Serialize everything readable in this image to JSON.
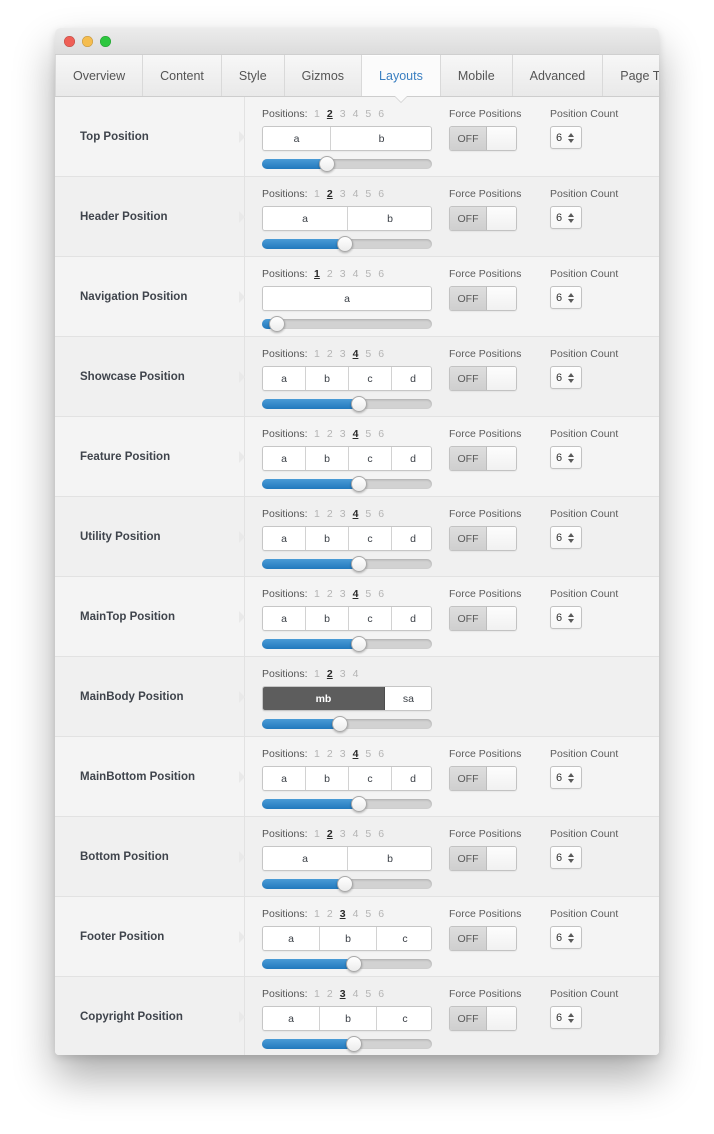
{
  "window": {
    "traffic_lights": [
      "close",
      "minimize",
      "maximize"
    ],
    "accent_blue": "#2279bd",
    "active_tab_color": "#3a7fc1"
  },
  "tabs": [
    {
      "label": "Overview",
      "active": false
    },
    {
      "label": "Content",
      "active": false
    },
    {
      "label": "Style",
      "active": false
    },
    {
      "label": "Gizmos",
      "active": false
    },
    {
      "label": "Layouts",
      "active": true
    },
    {
      "label": "Mobile",
      "active": false
    },
    {
      "label": "Advanced",
      "active": false
    },
    {
      "label": "Page Templates",
      "active": false
    }
  ],
  "labels": {
    "positions": "Positions:",
    "force_positions": "Force Positions",
    "position_count": "Position Count",
    "toggle_off": "OFF"
  },
  "rows": [
    {
      "name": "Top Position",
      "position_numbers": [
        "1",
        "2",
        "3",
        "4",
        "5",
        "6"
      ],
      "selected_position": "2",
      "segments": [
        {
          "label": "a",
          "width": 40,
          "dark": false
        },
        {
          "label": "b",
          "width": 60,
          "dark": false
        }
      ],
      "slider_percent": 38,
      "has_controls": true,
      "force_positions": "OFF",
      "position_count": "6"
    },
    {
      "name": "Header Position",
      "position_numbers": [
        "1",
        "2",
        "3",
        "4",
        "5",
        "6"
      ],
      "selected_position": "2",
      "segments": [
        {
          "label": "a",
          "width": 50,
          "dark": false
        },
        {
          "label": "b",
          "width": 50,
          "dark": false
        }
      ],
      "slider_percent": 49,
      "has_controls": true,
      "force_positions": "OFF",
      "position_count": "6"
    },
    {
      "name": "Navigation Position",
      "position_numbers": [
        "1",
        "2",
        "3",
        "4",
        "5",
        "6"
      ],
      "selected_position": "1",
      "segments": [
        {
          "label": "a",
          "width": 100,
          "dark": false
        }
      ],
      "slider_percent": 9,
      "has_controls": true,
      "force_positions": "OFF",
      "position_count": "6"
    },
    {
      "name": "Showcase Position",
      "position_numbers": [
        "1",
        "2",
        "3",
        "4",
        "5",
        "6"
      ],
      "selected_position": "4",
      "segments": [
        {
          "label": "a",
          "width": 25,
          "dark": false
        },
        {
          "label": "b",
          "width": 25,
          "dark": false
        },
        {
          "label": "c",
          "width": 25,
          "dark": false
        },
        {
          "label": "d",
          "width": 25,
          "dark": false
        }
      ],
      "slider_percent": 57,
      "has_controls": true,
      "force_positions": "OFF",
      "position_count": "6"
    },
    {
      "name": "Feature Position",
      "position_numbers": [
        "1",
        "2",
        "3",
        "4",
        "5",
        "6"
      ],
      "selected_position": "4",
      "segments": [
        {
          "label": "a",
          "width": 25,
          "dark": false
        },
        {
          "label": "b",
          "width": 25,
          "dark": false
        },
        {
          "label": "c",
          "width": 25,
          "dark": false
        },
        {
          "label": "d",
          "width": 25,
          "dark": false
        }
      ],
      "slider_percent": 57,
      "has_controls": true,
      "force_positions": "OFF",
      "position_count": "6"
    },
    {
      "name": "Utility Position",
      "position_numbers": [
        "1",
        "2",
        "3",
        "4",
        "5",
        "6"
      ],
      "selected_position": "4",
      "segments": [
        {
          "label": "a",
          "width": 25,
          "dark": false
        },
        {
          "label": "b",
          "width": 25,
          "dark": false
        },
        {
          "label": "c",
          "width": 25,
          "dark": false
        },
        {
          "label": "d",
          "width": 25,
          "dark": false
        }
      ],
      "slider_percent": 57,
      "has_controls": true,
      "force_positions": "OFF",
      "position_count": "6"
    },
    {
      "name": "MainTop Position",
      "position_numbers": [
        "1",
        "2",
        "3",
        "4",
        "5",
        "6"
      ],
      "selected_position": "4",
      "segments": [
        {
          "label": "a",
          "width": 25,
          "dark": false
        },
        {
          "label": "b",
          "width": 25,
          "dark": false
        },
        {
          "label": "c",
          "width": 25,
          "dark": false
        },
        {
          "label": "d",
          "width": 25,
          "dark": false
        }
      ],
      "slider_percent": 57,
      "has_controls": true,
      "force_positions": "OFF",
      "position_count": "6"
    },
    {
      "name": "MainBody Position",
      "position_numbers": [
        "1",
        "2",
        "3",
        "4"
      ],
      "selected_position": "2",
      "segments": [
        {
          "label": "mb",
          "width": 72,
          "dark": true
        },
        {
          "label": "sa",
          "width": 28,
          "dark": false
        }
      ],
      "slider_percent": 46,
      "has_controls": false,
      "force_positions": "",
      "position_count": ""
    },
    {
      "name": "MainBottom Position",
      "position_numbers": [
        "1",
        "2",
        "3",
        "4",
        "5",
        "6"
      ],
      "selected_position": "4",
      "segments": [
        {
          "label": "a",
          "width": 25,
          "dark": false
        },
        {
          "label": "b",
          "width": 25,
          "dark": false
        },
        {
          "label": "c",
          "width": 25,
          "dark": false
        },
        {
          "label": "d",
          "width": 25,
          "dark": false
        }
      ],
      "slider_percent": 57,
      "has_controls": true,
      "force_positions": "OFF",
      "position_count": "6"
    },
    {
      "name": "Bottom Position",
      "position_numbers": [
        "1",
        "2",
        "3",
        "4",
        "5",
        "6"
      ],
      "selected_position": "2",
      "segments": [
        {
          "label": "a",
          "width": 50,
          "dark": false
        },
        {
          "label": "b",
          "width": 50,
          "dark": false
        }
      ],
      "slider_percent": 49,
      "has_controls": true,
      "force_positions": "OFF",
      "position_count": "6"
    },
    {
      "name": "Footer Position",
      "position_numbers": [
        "1",
        "2",
        "3",
        "4",
        "5",
        "6"
      ],
      "selected_position": "3",
      "segments": [
        {
          "label": "a",
          "width": 33.34,
          "dark": false
        },
        {
          "label": "b",
          "width": 33.33,
          "dark": false
        },
        {
          "label": "c",
          "width": 33.33,
          "dark": false
        }
      ],
      "slider_percent": 54,
      "has_controls": true,
      "force_positions": "OFF",
      "position_count": "6"
    },
    {
      "name": "Copyright Position",
      "position_numbers": [
        "1",
        "2",
        "3",
        "4",
        "5",
        "6"
      ],
      "selected_position": "3",
      "segments": [
        {
          "label": "a",
          "width": 33.34,
          "dark": false
        },
        {
          "label": "b",
          "width": 33.33,
          "dark": false
        },
        {
          "label": "c",
          "width": 33.33,
          "dark": false
        }
      ],
      "slider_percent": 54,
      "has_controls": true,
      "force_positions": "OFF",
      "position_count": "6"
    }
  ]
}
